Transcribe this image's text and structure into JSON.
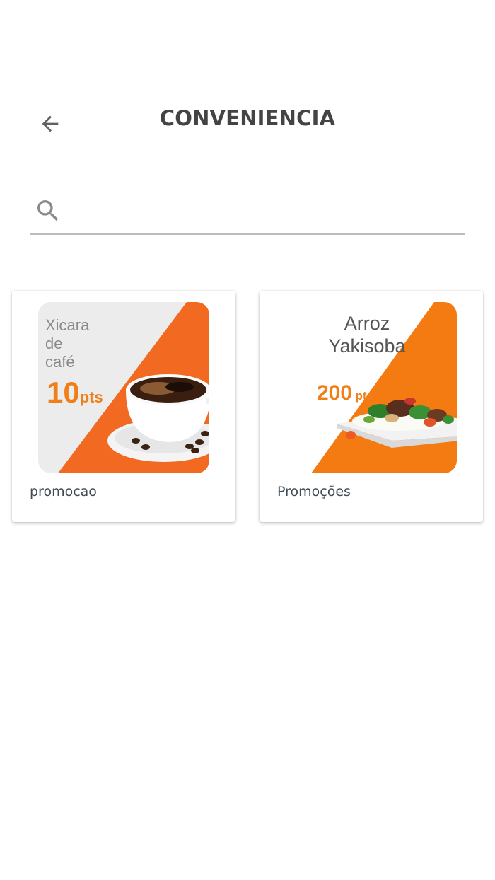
{
  "header": {
    "title": "CONVENIENCIA",
    "back_icon": "arrow-left-icon"
  },
  "search": {
    "icon": "search-icon",
    "value": "",
    "placeholder": ""
  },
  "products": [
    {
      "name_lines": [
        "Xicara",
        "de",
        "café"
      ],
      "points": "10",
      "points_unit": "pts",
      "label": "promocao"
    },
    {
      "name_lines": [
        "Arroz",
        "Yakisoba"
      ],
      "points": "200",
      "points_unit": "pts",
      "label": "Promoções"
    }
  ],
  "colors": {
    "accent": "#f07f1a",
    "card_bg": "#ffffff",
    "divider": "#bdbdbd"
  }
}
